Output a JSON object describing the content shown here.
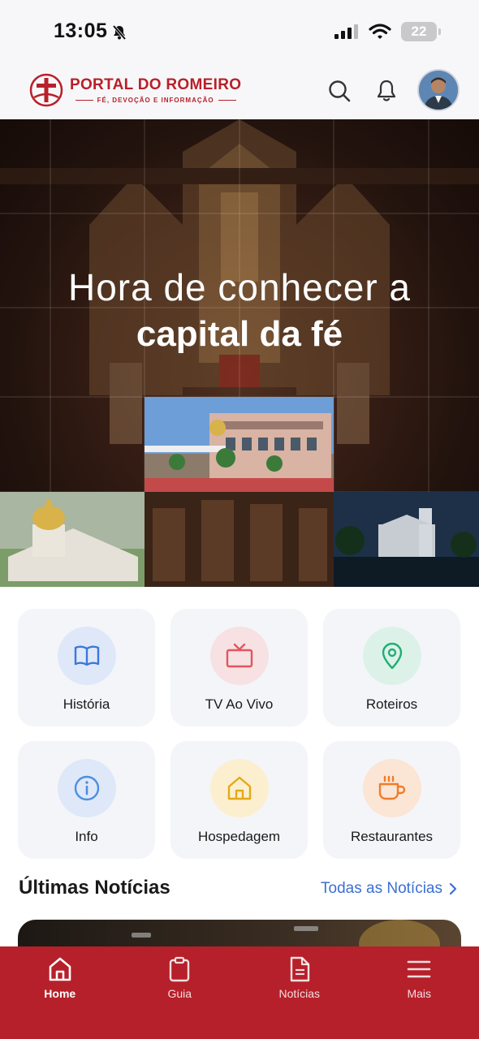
{
  "status_bar": {
    "time": "13:05",
    "battery": "22"
  },
  "header": {
    "logo_title": "PORTAL DO ROMEIRO",
    "logo_subtitle": "FÉ, DEVOÇÃO E INFORMAÇÃO",
    "icons": [
      "search-icon",
      "bell-icon",
      "avatar"
    ]
  },
  "hero": {
    "title_line1": "Hora de conhecer a",
    "title_line2": "capital da fé"
  },
  "quick_access": [
    {
      "label": "História",
      "icon": "book-icon",
      "bg": "#dfe8f8",
      "color": "#3b78d8"
    },
    {
      "label": "TV Ao Vivo",
      "icon": "tv-icon",
      "bg": "#f7e1e3",
      "color": "#e2555f"
    },
    {
      "label": "Roteiros",
      "icon": "map-pin-icon",
      "bg": "#dcf2e8",
      "color": "#1fae73"
    },
    {
      "label": "Info",
      "icon": "info-icon",
      "bg": "#dfe8f8",
      "color": "#4b8fe3"
    },
    {
      "label": "Hospedagem",
      "icon": "house-icon",
      "bg": "#fbefcf",
      "color": "#e6a817"
    },
    {
      "label": "Restaurantes",
      "icon": "coffee-icon",
      "bg": "#fbe5d5",
      "color": "#ef7c2a"
    }
  ],
  "news": {
    "section_title": "Últimas Notícias",
    "see_all": "Todas as Notícias"
  },
  "bottom_nav": [
    {
      "label": "Home",
      "icon": "home-icon",
      "active": true
    },
    {
      "label": "Guia",
      "icon": "clipboard-icon",
      "active": false
    },
    {
      "label": "Notícias",
      "icon": "document-icon",
      "active": false
    },
    {
      "label": "Mais",
      "icon": "menu-icon",
      "active": false
    }
  ],
  "colors": {
    "brand_red": "#b6202a",
    "link_blue": "#3b6fd3",
    "card_bg": "#f4f5f9"
  }
}
